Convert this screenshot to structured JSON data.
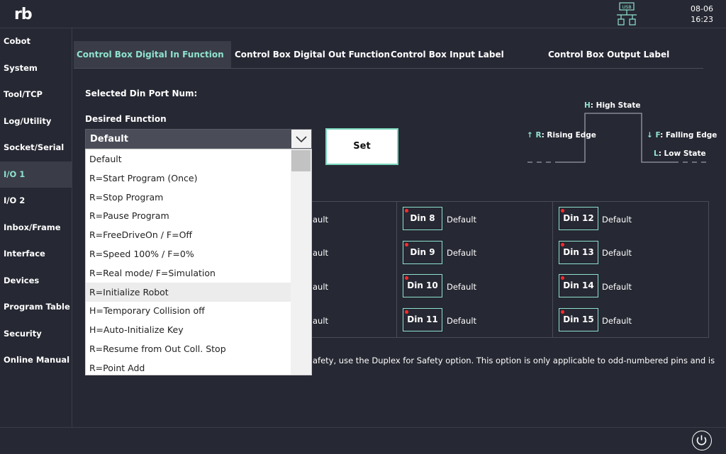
{
  "header": {
    "logo": "rb",
    "date": "08-06",
    "time": "16:23",
    "usb_label": "USB"
  },
  "sidebar": {
    "items": [
      {
        "label": "Cobot"
      },
      {
        "label": "System"
      },
      {
        "label": "Tool/TCP"
      },
      {
        "label": "Log/Utility"
      },
      {
        "label": "Socket/Serial"
      },
      {
        "label": "I/O 1"
      },
      {
        "label": "I/O 2"
      },
      {
        "label": "Inbox/Frame"
      },
      {
        "label": "Interface"
      },
      {
        "label": "Devices"
      },
      {
        "label": "Program Table"
      },
      {
        "label": "Security"
      },
      {
        "label": "Online Manual"
      }
    ],
    "active_index": 5
  },
  "tabs": [
    {
      "label": "Control Box Digital In Function"
    },
    {
      "label": "Control Box Digital Out Function"
    },
    {
      "label": "Control Box Input Label"
    },
    {
      "label": "Control Box Output Label"
    }
  ],
  "main": {
    "selected_port_label": "Selected Din Port Num:",
    "desired_function_label": "Desired Function",
    "set_button": "Set"
  },
  "dropdown": {
    "selected": "Default",
    "options": [
      "Default",
      "R=Start Program (Once)",
      "R=Stop Program",
      "R=Pause Program",
      "R=FreeDriveOn / F=Off",
      "R=Speed 100% / F=0%",
      "R=Real mode/ F=Simulation",
      "R=Initialize Robot",
      "H=Temporary Collision off",
      "H=Auto-Initialize Key",
      "R=Resume from Out Coll. Stop",
      "R=Point Add"
    ],
    "highlighted_index": 7
  },
  "diagram": {
    "high_key": "H",
    "high_text": ": High State",
    "rising_arrow": "↑",
    "rising_key": "R",
    "rising_text": ": Rising Edge",
    "falling_arrow": "↓",
    "falling_key": "F",
    "falling_text": ": Falling Edge",
    "low_key": "L",
    "low_text": ": Low State"
  },
  "din_grid": {
    "partial_col_text": "ault",
    "col2": [
      {
        "name": "Din 8",
        "function": "Default"
      },
      {
        "name": "Din 9",
        "function": "Default"
      },
      {
        "name": "Din 10",
        "function": "Default"
      },
      {
        "name": "Din 11",
        "function": "Default"
      }
    ],
    "col3": [
      {
        "name": "Din 12",
        "function": "Default"
      },
      {
        "name": "Din 13",
        "function": "Default"
      },
      {
        "name": "Din 14",
        "function": "Default"
      },
      {
        "name": "Din 15",
        "function": "Default"
      }
    ]
  },
  "note": "afety, use the Duplex for Safety option. This option is only applicable to odd-numbered pins and is",
  "colors": {
    "background": "#262833",
    "accent": "#8fe3ce",
    "panel": "#3a3d48",
    "status_dot": "#ff2a2a"
  }
}
